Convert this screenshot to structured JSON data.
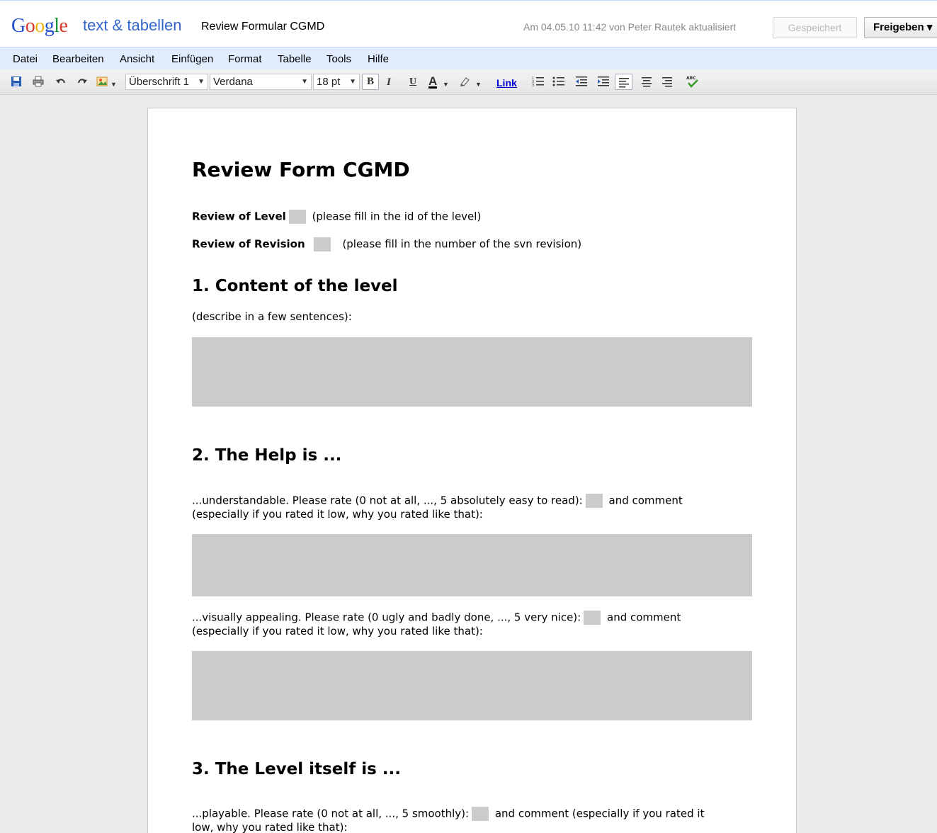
{
  "header": {
    "product": "text & tabellen",
    "doc_title": "Review Formular CGMD",
    "last_edit": "Am 04.05.10 11:42 von Peter Rautek aktualisiert",
    "saved_label": "Gespeichert",
    "share_label": "Freigeben ▾"
  },
  "menu": [
    "Datei",
    "Bearbeiten",
    "Ansicht",
    "Einfügen",
    "Format",
    "Tabelle",
    "Tools",
    "Hilfe"
  ],
  "toolbar": {
    "style_value": "Überschrift 1",
    "font_value": "Verdana",
    "size_value": "18 pt",
    "bold_label": "B",
    "italic_label": "I",
    "underline_label": "U",
    "text_color_label": "A",
    "link_label": "Link",
    "spellcheck_label": "ABC"
  },
  "document": {
    "title": "Review Form CGMD",
    "level_label": "Review of Level",
    "level_hint": "(please fill in the id of the level)",
    "revision_label": "Review of Revision",
    "revision_hint": "(please fill in the number of the svn revision)",
    "section1_heading": "1. Content of the level",
    "section1_text": "(describe in a few sentences):",
    "section2_heading": "2. The Help is ...",
    "help_understandable_a": "...understandable. Please rate (0 not at all, ..., 5 absolutely easy to read):",
    "help_understandable_b": "and comment",
    "help_understandable_c": "(especially if you rated it low, why you rated like that):",
    "help_visual_a": "...visually appealing. Please rate (0 ugly and badly done, ..., 5 very nice):",
    "help_visual_b": "and comment",
    "help_visual_c": "(especially if you rated it low, why you rated like that):",
    "section3_heading": "3. The Level itself is ...",
    "level_playable_a": "...playable. Please rate (0 not at all, ..., 5 smoothly):",
    "level_playable_b": "and comment (especially if you rated it",
    "level_playable_c": "low, why you rated like that):"
  }
}
